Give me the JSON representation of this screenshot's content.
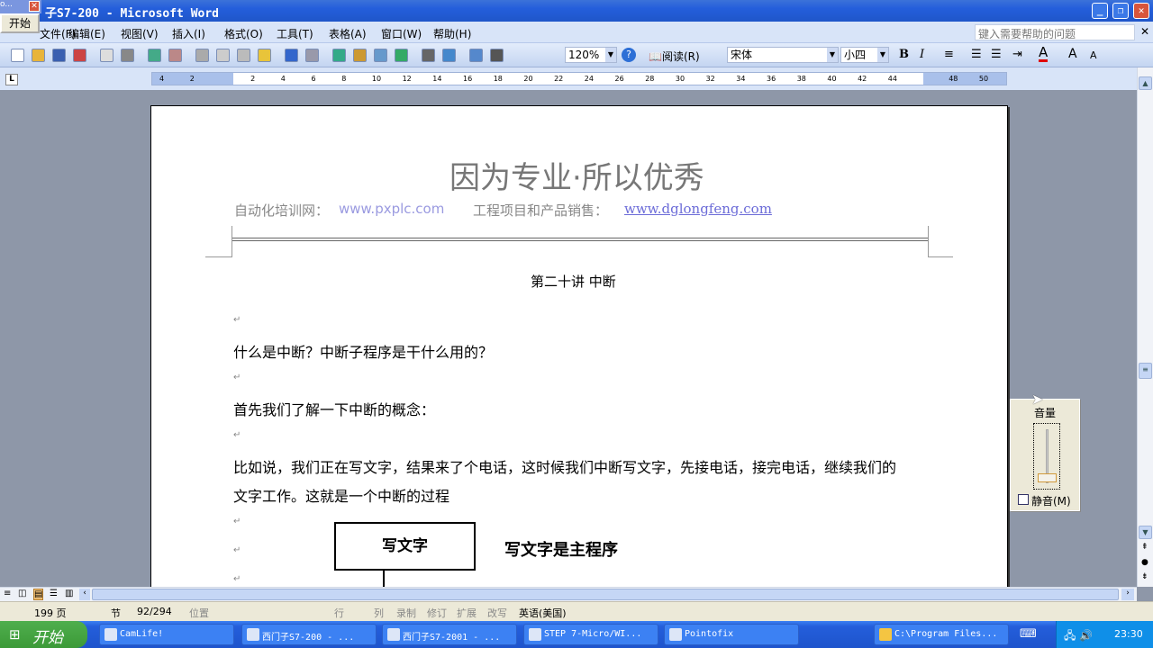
{
  "window": {
    "title": "子S7-200 - Microsoft Word",
    "mini_label": "o...",
    "start_popup": "开始"
  },
  "menu": [
    "文件(F)",
    "编辑(E)",
    "视图(V)",
    "插入(I)",
    "格式(O)",
    "工具(T)",
    "表格(A)",
    "窗口(W)",
    "帮助(H)"
  ],
  "help_placeholder": "键入需要帮助的问题",
  "toolbar": {
    "zoom": "120%",
    "read_label": "阅读(R)",
    "font": "宋体",
    "size": "小四",
    "bold": "B",
    "italic": "I",
    "font_color": "#e00000",
    "icons": [
      "new-icon",
      "open-icon",
      "save-icon",
      "permission-icon",
      "print-icon",
      "print-preview-icon",
      "spelling-icon",
      "research-icon",
      "cut-icon",
      "copy-icon",
      "paste-icon",
      "format-painter-icon",
      "undo-icon",
      "redo-icon",
      "hyperlink-icon",
      "tables-borders-icon",
      "insert-table-icon",
      "insert-excel-icon",
      "columns-icon",
      "drawing-icon",
      "document-map-icon",
      "show-hide-icon"
    ]
  },
  "ruler": {
    "ticks": [
      "4",
      "2",
      "",
      "2",
      "4",
      "6",
      "8",
      "10",
      "12",
      "14",
      "16",
      "18",
      "20",
      "22",
      "24",
      "26",
      "28",
      "30",
      "32",
      "34",
      "36",
      "38",
      "40",
      "42",
      "44",
      "",
      "48",
      "50"
    ]
  },
  "document": {
    "header_title": "因为专业·所以优秀",
    "header_left_label": "自动化培训网：",
    "header_left_link": "www.pxplc.com",
    "header_right_label": "工程项目和产品销售：",
    "header_right_link": "www.dglongfeng.com",
    "lecture_title": "第二十讲  中断",
    "q1": "什么是中断？中断子程序是干什么用的？",
    "p1": "首先我们了解一下中断的概念：",
    "p2a": "比如说，我们正在写文字，结果来了个电话，这时候我们中断写文字，先接电话，接完电话，继续我们的",
    "p2b": "文字工作。这就是一个中断的过程",
    "box_label": "写文字",
    "box_caption": "写文字是主程序"
  },
  "volume": {
    "title": "音量",
    "mute_label": "静音(M)",
    "level": 0.05,
    "muted": false
  },
  "status": {
    "page": "199 页",
    "section": "节",
    "pages": "92/294",
    "position": "位置",
    "line": "行",
    "col": "列",
    "rec": "录制",
    "trk": "修订",
    "ext": "扩展",
    "ovr": "改写",
    "lang": "英语(美国)"
  },
  "taskbar": {
    "start": "开始",
    "tasks": [
      "CamLife!",
      "西门子S7-200 - ...",
      "西门子S7-2001 - ...",
      "STEP 7-Micro/WI...",
      "Pointofix",
      "C:\\Program Files..."
    ],
    "clock": "23:30"
  }
}
